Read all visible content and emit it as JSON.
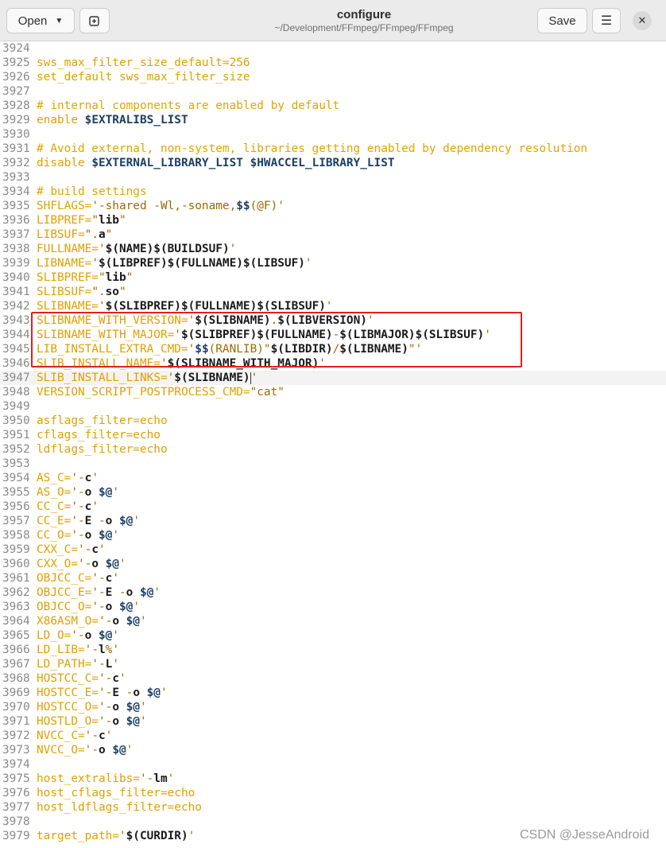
{
  "window": {
    "title": "configure",
    "subtitle": "~/Development/FFmpeg/FFmpeg/FFmpeg"
  },
  "toolbar": {
    "open_label": "Open",
    "open_icon": "chevron-down-icon",
    "new_tab_icon": "new-tab-icon",
    "save_label": "Save",
    "menu_icon": "hamburger-menu-icon",
    "close_icon": "close-icon"
  },
  "editor": {
    "current_line": "3947",
    "lines": [
      {
        "n": "3924",
        "segments": []
      },
      {
        "n": "3925",
        "segments": [
          {
            "t": "sws_max_filter_size_default=256",
            "c": "o"
          }
        ]
      },
      {
        "n": "3926",
        "segments": [
          {
            "t": "set_default sws_max_filter_size",
            "c": "o"
          }
        ]
      },
      {
        "n": "3927",
        "segments": []
      },
      {
        "n": "3928",
        "segments": [
          {
            "t": "# internal components are enabled by default",
            "c": "c"
          }
        ]
      },
      {
        "n": "3929",
        "segments": [
          {
            "t": "enable ",
            "c": "o"
          },
          {
            "t": "$EXTRALIBS_LIST",
            "c": "k"
          }
        ]
      },
      {
        "n": "3930",
        "segments": []
      },
      {
        "n": "3931",
        "segments": [
          {
            "t": "# Avoid external, non-system, libraries getting enabled by dependency resolution",
            "c": "c"
          }
        ]
      },
      {
        "n": "3932",
        "segments": [
          {
            "t": "disable ",
            "c": "o"
          },
          {
            "t": "$EXTERNAL_LIBRARY_LIST",
            "c": "k"
          },
          {
            "t": " ",
            "c": "o"
          },
          {
            "t": "$HWACCEL_LIBRARY_LIST",
            "c": "k"
          }
        ]
      },
      {
        "n": "3933",
        "segments": []
      },
      {
        "n": "3934",
        "segments": [
          {
            "t": "# build settings",
            "c": "c"
          }
        ]
      },
      {
        "n": "3935",
        "segments": [
          {
            "t": "SHFLAGS=",
            "c": "o"
          },
          {
            "t": "'-shared -Wl,-soname,",
            "c": "s"
          },
          {
            "t": "$$",
            "c": "k"
          },
          {
            "t": "(@F)'",
            "c": "s"
          }
        ]
      },
      {
        "n": "3936",
        "segments": [
          {
            "t": "LIBPREF=",
            "c": "o"
          },
          {
            "t": "\"",
            "c": "s"
          },
          {
            "t": "lib",
            "c": "b"
          },
          {
            "t": "\"",
            "c": "s"
          }
        ]
      },
      {
        "n": "3937",
        "segments": [
          {
            "t": "LIBSUF=",
            "c": "o"
          },
          {
            "t": "\".",
            "c": "s"
          },
          {
            "t": "a",
            "c": "b"
          },
          {
            "t": "\"",
            "c": "s"
          }
        ]
      },
      {
        "n": "3938",
        "segments": [
          {
            "t": "FULLNAME=",
            "c": "o"
          },
          {
            "t": "'",
            "c": "s"
          },
          {
            "t": "$(NAME)$(BUILDSUF)",
            "c": "b"
          },
          {
            "t": "'",
            "c": "s"
          }
        ]
      },
      {
        "n": "3939",
        "segments": [
          {
            "t": "LIBNAME=",
            "c": "o"
          },
          {
            "t": "'",
            "c": "s"
          },
          {
            "t": "$(LIBPREF)$(FULLNAME)$(LIBSUF)",
            "c": "b"
          },
          {
            "t": "'",
            "c": "s"
          }
        ]
      },
      {
        "n": "3940",
        "segments": [
          {
            "t": "SLIBPREF=",
            "c": "o"
          },
          {
            "t": "\"",
            "c": "s"
          },
          {
            "t": "lib",
            "c": "b"
          },
          {
            "t": "\"",
            "c": "s"
          }
        ]
      },
      {
        "n": "3941",
        "segments": [
          {
            "t": "SLIBSUF=",
            "c": "o"
          },
          {
            "t": "\".",
            "c": "s"
          },
          {
            "t": "so",
            "c": "b"
          },
          {
            "t": "\"",
            "c": "s"
          }
        ]
      },
      {
        "n": "3942",
        "segments": [
          {
            "t": "SLIBNAME=",
            "c": "o"
          },
          {
            "t": "'",
            "c": "s"
          },
          {
            "t": "$(SLIBPREF)$(FULLNAME)$(SLIBSUF)",
            "c": "b"
          },
          {
            "t": "'",
            "c": "s"
          }
        ]
      },
      {
        "n": "3943",
        "segments": [
          {
            "t": "SLIBNAME_WITH_VERSION=",
            "c": "o"
          },
          {
            "t": "'",
            "c": "s"
          },
          {
            "t": "$(SLIBNAME)",
            "c": "b"
          },
          {
            "t": ".",
            "c": "s"
          },
          {
            "t": "$(LIBVERSION)",
            "c": "b"
          },
          {
            "t": "'",
            "c": "s"
          }
        ]
      },
      {
        "n": "3944",
        "segments": [
          {
            "t": "SLIBNAME_WITH_MAJOR=",
            "c": "o"
          },
          {
            "t": "'",
            "c": "s"
          },
          {
            "t": "$(SLIBPREF)$(FULLNAME)",
            "c": "b"
          },
          {
            "t": "-",
            "c": "s"
          },
          {
            "t": "$(LIBMAJOR)$(SLIBSUF)",
            "c": "b"
          },
          {
            "t": "'",
            "c": "s"
          }
        ]
      },
      {
        "n": "3945",
        "segments": [
          {
            "t": "LIB_INSTALL_EXTRA_CMD=",
            "c": "o"
          },
          {
            "t": "'",
            "c": "s"
          },
          {
            "t": "$$",
            "c": "k"
          },
          {
            "t": "(RANLIB)\"",
            "c": "s"
          },
          {
            "t": "$(LIBDIR)",
            "c": "b"
          },
          {
            "t": "/",
            "c": "s"
          },
          {
            "t": "$(LIBNAME)",
            "c": "b"
          },
          {
            "t": "\"'",
            "c": "s"
          }
        ]
      },
      {
        "n": "3946",
        "segments": [
          {
            "t": "SLIB_INSTALL_NAME=",
            "c": "o"
          },
          {
            "t": "'",
            "c": "s"
          },
          {
            "t": "$(SLIBNAME_WITH_MAJOR)",
            "c": "b"
          },
          {
            "t": "'",
            "c": "s"
          }
        ]
      },
      {
        "n": "3947",
        "segments": [
          {
            "t": "SLIB_INSTALL_LINKS=",
            "c": "o"
          },
          {
            "t": "'",
            "c": "s"
          },
          {
            "t": "$(SLIBNAME)",
            "c": "b"
          },
          {
            "t": "'",
            "c": "s"
          }
        ]
      },
      {
        "n": "3948",
        "segments": [
          {
            "t": "VERSION_SCRIPT_POSTPROCESS_CMD=",
            "c": "o"
          },
          {
            "t": "\"cat\"",
            "c": "s"
          }
        ]
      },
      {
        "n": "3949",
        "segments": []
      },
      {
        "n": "3950",
        "segments": [
          {
            "t": "asflags_filter=echo",
            "c": "o"
          }
        ]
      },
      {
        "n": "3951",
        "segments": [
          {
            "t": "cflags_filter=echo",
            "c": "o"
          }
        ]
      },
      {
        "n": "3952",
        "segments": [
          {
            "t": "ldflags_filter=echo",
            "c": "o"
          }
        ]
      },
      {
        "n": "3953",
        "segments": []
      },
      {
        "n": "3954",
        "segments": [
          {
            "t": "AS_C=",
            "c": "o"
          },
          {
            "t": "'-",
            "c": "s"
          },
          {
            "t": "c",
            "c": "b"
          },
          {
            "t": "'",
            "c": "s"
          }
        ]
      },
      {
        "n": "3955",
        "segments": [
          {
            "t": "AS_O=",
            "c": "o"
          },
          {
            "t": "'-",
            "c": "s"
          },
          {
            "t": "o ",
            "c": "b"
          },
          {
            "t": "$@",
            "c": "k"
          },
          {
            "t": "'",
            "c": "s"
          }
        ]
      },
      {
        "n": "3956",
        "segments": [
          {
            "t": "CC_C=",
            "c": "o"
          },
          {
            "t": "'-",
            "c": "s"
          },
          {
            "t": "c",
            "c": "b"
          },
          {
            "t": "'",
            "c": "s"
          }
        ]
      },
      {
        "n": "3957",
        "segments": [
          {
            "t": "CC_E=",
            "c": "o"
          },
          {
            "t": "'-",
            "c": "s"
          },
          {
            "t": "E ",
            "c": "b"
          },
          {
            "t": "-",
            "c": "s"
          },
          {
            "t": "o ",
            "c": "b"
          },
          {
            "t": "$@",
            "c": "k"
          },
          {
            "t": "'",
            "c": "s"
          }
        ]
      },
      {
        "n": "3958",
        "segments": [
          {
            "t": "CC_O=",
            "c": "o"
          },
          {
            "t": "'-",
            "c": "s"
          },
          {
            "t": "o ",
            "c": "b"
          },
          {
            "t": "$@",
            "c": "k"
          },
          {
            "t": "'",
            "c": "s"
          }
        ]
      },
      {
        "n": "3959",
        "segments": [
          {
            "t": "CXX_C=",
            "c": "o"
          },
          {
            "t": "'-",
            "c": "s"
          },
          {
            "t": "c",
            "c": "b"
          },
          {
            "t": "'",
            "c": "s"
          }
        ]
      },
      {
        "n": "3960",
        "segments": [
          {
            "t": "CXX_O=",
            "c": "o"
          },
          {
            "t": "'-",
            "c": "s"
          },
          {
            "t": "o ",
            "c": "b"
          },
          {
            "t": "$@",
            "c": "k"
          },
          {
            "t": "'",
            "c": "s"
          }
        ]
      },
      {
        "n": "3961",
        "segments": [
          {
            "t": "OBJCC_C=",
            "c": "o"
          },
          {
            "t": "'-",
            "c": "s"
          },
          {
            "t": "c",
            "c": "b"
          },
          {
            "t": "'",
            "c": "s"
          }
        ]
      },
      {
        "n": "3962",
        "segments": [
          {
            "t": "OBJCC_E=",
            "c": "o"
          },
          {
            "t": "'-",
            "c": "s"
          },
          {
            "t": "E ",
            "c": "b"
          },
          {
            "t": "-",
            "c": "s"
          },
          {
            "t": "o ",
            "c": "b"
          },
          {
            "t": "$@",
            "c": "k"
          },
          {
            "t": "'",
            "c": "s"
          }
        ]
      },
      {
        "n": "3963",
        "segments": [
          {
            "t": "OBJCC_O=",
            "c": "o"
          },
          {
            "t": "'-",
            "c": "s"
          },
          {
            "t": "o ",
            "c": "b"
          },
          {
            "t": "$@",
            "c": "k"
          },
          {
            "t": "'",
            "c": "s"
          }
        ]
      },
      {
        "n": "3964",
        "segments": [
          {
            "t": "X86ASM_O=",
            "c": "o"
          },
          {
            "t": "'-",
            "c": "s"
          },
          {
            "t": "o ",
            "c": "b"
          },
          {
            "t": "$@",
            "c": "k"
          },
          {
            "t": "'",
            "c": "s"
          }
        ]
      },
      {
        "n": "3965",
        "segments": [
          {
            "t": "LD_O=",
            "c": "o"
          },
          {
            "t": "'-",
            "c": "s"
          },
          {
            "t": "o ",
            "c": "b"
          },
          {
            "t": "$@",
            "c": "k"
          },
          {
            "t": "'",
            "c": "s"
          }
        ]
      },
      {
        "n": "3966",
        "segments": [
          {
            "t": "LD_LIB=",
            "c": "o"
          },
          {
            "t": "'-",
            "c": "s"
          },
          {
            "t": "l",
            "c": "b"
          },
          {
            "t": "%'",
            "c": "s"
          }
        ]
      },
      {
        "n": "3967",
        "segments": [
          {
            "t": "LD_PATH=",
            "c": "o"
          },
          {
            "t": "'-",
            "c": "s"
          },
          {
            "t": "L",
            "c": "b"
          },
          {
            "t": "'",
            "c": "s"
          }
        ]
      },
      {
        "n": "3968",
        "segments": [
          {
            "t": "HOSTCC_C=",
            "c": "o"
          },
          {
            "t": "'-",
            "c": "s"
          },
          {
            "t": "c",
            "c": "b"
          },
          {
            "t": "'",
            "c": "s"
          }
        ]
      },
      {
        "n": "3969",
        "segments": [
          {
            "t": "HOSTCC_E=",
            "c": "o"
          },
          {
            "t": "'-",
            "c": "s"
          },
          {
            "t": "E ",
            "c": "b"
          },
          {
            "t": "-",
            "c": "s"
          },
          {
            "t": "o ",
            "c": "b"
          },
          {
            "t": "$@",
            "c": "k"
          },
          {
            "t": "'",
            "c": "s"
          }
        ]
      },
      {
        "n": "3970",
        "segments": [
          {
            "t": "HOSTCC_O=",
            "c": "o"
          },
          {
            "t": "'-",
            "c": "s"
          },
          {
            "t": "o ",
            "c": "b"
          },
          {
            "t": "$@",
            "c": "k"
          },
          {
            "t": "'",
            "c": "s"
          }
        ]
      },
      {
        "n": "3971",
        "segments": [
          {
            "t": "HOSTLD_O=",
            "c": "o"
          },
          {
            "t": "'-",
            "c": "s"
          },
          {
            "t": "o ",
            "c": "b"
          },
          {
            "t": "$@",
            "c": "k"
          },
          {
            "t": "'",
            "c": "s"
          }
        ]
      },
      {
        "n": "3972",
        "segments": [
          {
            "t": "NVCC_C=",
            "c": "o"
          },
          {
            "t": "'-",
            "c": "s"
          },
          {
            "t": "c",
            "c": "b"
          },
          {
            "t": "'",
            "c": "s"
          }
        ]
      },
      {
        "n": "3973",
        "segments": [
          {
            "t": "NVCC_O=",
            "c": "o"
          },
          {
            "t": "'-",
            "c": "s"
          },
          {
            "t": "o ",
            "c": "b"
          },
          {
            "t": "$@",
            "c": "k"
          },
          {
            "t": "'",
            "c": "s"
          }
        ]
      },
      {
        "n": "3974",
        "segments": []
      },
      {
        "n": "3975",
        "segments": [
          {
            "t": "host_extralibs=",
            "c": "o"
          },
          {
            "t": "'-",
            "c": "s"
          },
          {
            "t": "lm",
            "c": "b"
          },
          {
            "t": "'",
            "c": "s"
          }
        ]
      },
      {
        "n": "3976",
        "segments": [
          {
            "t": "host_cflags_filter=echo",
            "c": "o"
          }
        ]
      },
      {
        "n": "3977",
        "segments": [
          {
            "t": "host_ldflags_filter=echo",
            "c": "o"
          }
        ]
      },
      {
        "n": "3978",
        "segments": []
      },
      {
        "n": "3979",
        "segments": [
          {
            "t": "target_path=",
            "c": "o"
          },
          {
            "t": "'",
            "c": "s"
          },
          {
            "t": "$(CURDIR)",
            "c": "b"
          },
          {
            "t": "'",
            "c": "s"
          }
        ]
      }
    ]
  },
  "watermark": "CSDN @JesseAndroid",
  "colors": {
    "highlight_box": "#e02020",
    "text_orange": "#e0a000",
    "variable_blue": "#1c3f66"
  }
}
